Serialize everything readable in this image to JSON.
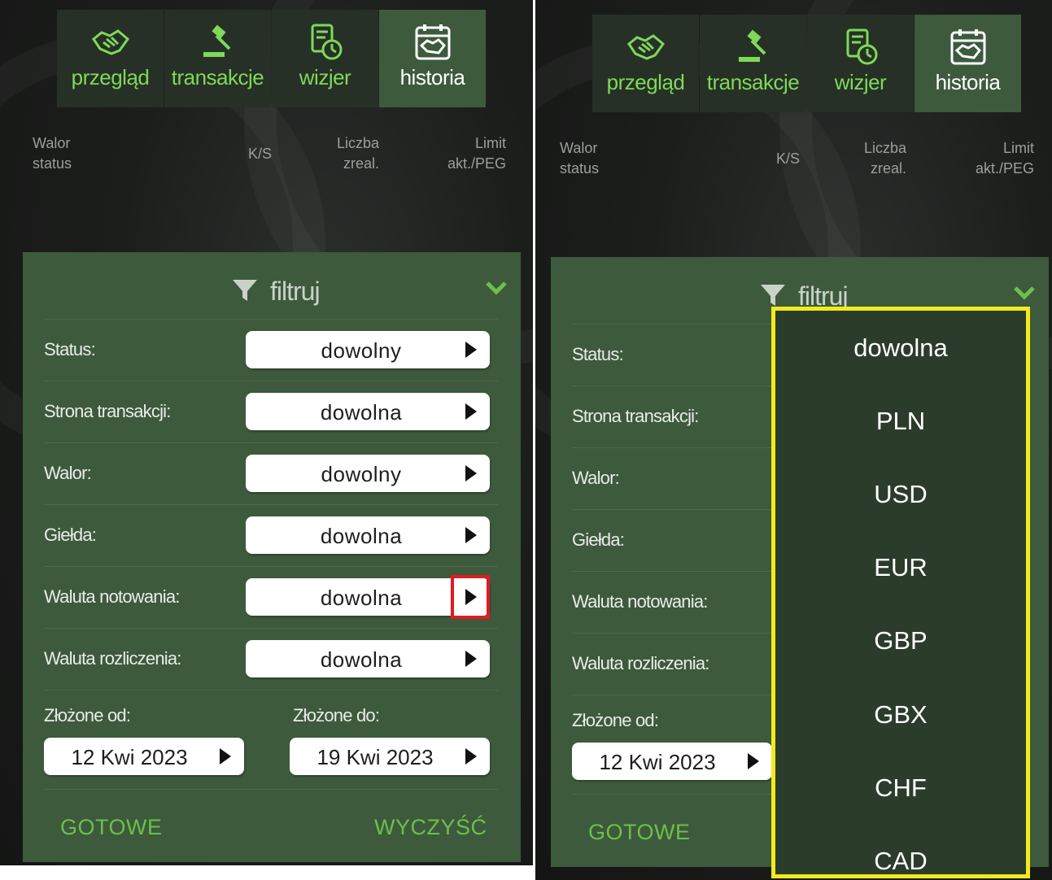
{
  "tabs": [
    {
      "label": "przegląd",
      "icon": "handshake-icon"
    },
    {
      "label": "transakcje",
      "icon": "gavel-icon"
    },
    {
      "label": "wizjer",
      "icon": "report-clock-icon"
    },
    {
      "label": "historia",
      "icon": "calendar-handshake-icon"
    }
  ],
  "active_tab": "historia",
  "columns": {
    "walor": "Walor",
    "status": "status",
    "ks": "K/S",
    "liczba": "Liczba",
    "zreal": "zreal.",
    "limit": "Limit",
    "akt_peg": "akt./PEG"
  },
  "filter": {
    "title": "filtruj",
    "rows": [
      {
        "label": "Status:",
        "value": "dowolny"
      },
      {
        "label": "Strona transakcji:",
        "value": "dowolna"
      },
      {
        "label": "Walor:",
        "value": "dowolny"
      },
      {
        "label": "Giełda:",
        "value": "dowolna"
      },
      {
        "label": "Waluta notowania:",
        "value": "dowolna"
      },
      {
        "label": "Waluta rozliczenia:",
        "value": "dowolna"
      }
    ],
    "date_from_label": "Złożone od:",
    "date_to_label": "Złożone do:",
    "date_from": "12 Kwi 2023",
    "date_to": "19 Kwi 2023",
    "done_label": "GOTOWE",
    "clear_label": "WYCZYŚĆ"
  },
  "currency_dropdown": [
    "dowolna",
    "PLN",
    "USD",
    "EUR",
    "GBP",
    "GBX",
    "CHF",
    "CAD"
  ],
  "colors": {
    "accent_green": "#7ed957",
    "filter_bg": "#3d5a3c",
    "highlight_red": "#e01b22",
    "highlight_yellow": "#f2ea1d"
  }
}
